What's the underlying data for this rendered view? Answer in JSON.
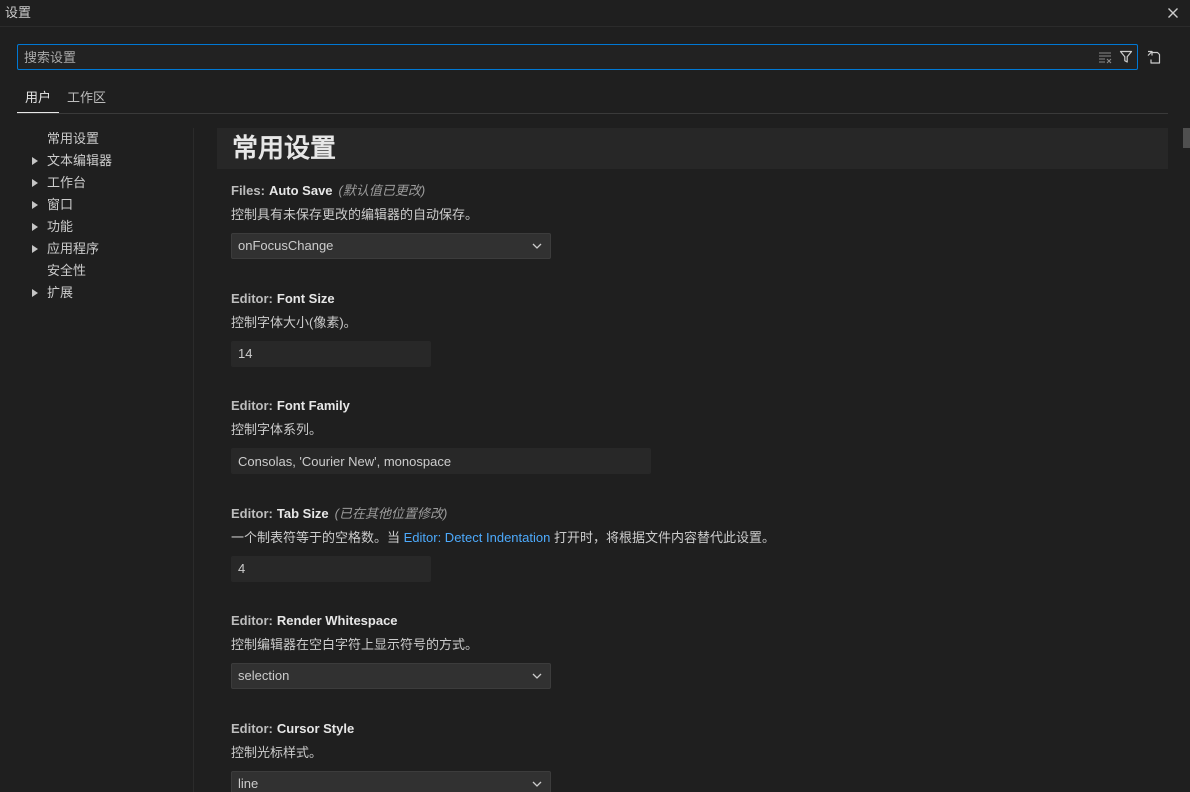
{
  "window": {
    "title": "设置",
    "close_icon": "close-icon"
  },
  "search": {
    "placeholder": "搜索设置",
    "icons": [
      "clear-filter-icon",
      "filter-icon"
    ],
    "open_json_icon": "open-settings-json-icon"
  },
  "tabs": [
    {
      "label": "用户",
      "active": true
    },
    {
      "label": "工作区",
      "active": false
    }
  ],
  "toc": [
    {
      "label": "常用设置",
      "expandable": false
    },
    {
      "label": "文本编辑器",
      "expandable": true
    },
    {
      "label": "工作台",
      "expandable": true
    },
    {
      "label": "窗口",
      "expandable": true
    },
    {
      "label": "功能",
      "expandable": true
    },
    {
      "label": "应用程序",
      "expandable": true
    },
    {
      "label": "安全性",
      "expandable": false
    },
    {
      "label": "扩展",
      "expandable": true
    }
  ],
  "section": {
    "title": "常用设置"
  },
  "settings": [
    {
      "category": "Files:",
      "name": "Auto Save",
      "modified": "(默认值已更改)",
      "description": "控制具有未保存更改的编辑器的自动保存。",
      "dropdown": true,
      "value": "onFocusChange"
    },
    {
      "category": "Editor:",
      "name": "Font Size",
      "description": "控制字体大小(像素)。",
      "dropdown": false,
      "value": "14"
    },
    {
      "category": "Editor:",
      "name": "Font Family",
      "description": "控制字体系列。",
      "dropdown": false,
      "value": "Consolas, 'Courier New', monospace"
    },
    {
      "category": "Editor:",
      "name": "Tab Size",
      "modified": "(已在其他位置修改)",
      "description": "一个制表符等于的空格数。当 ",
      "description_link": "Editor: Detect Indentation",
      "description_after": " 打开时，将根据文件内容替代此设置。",
      "dropdown": false,
      "value": "4"
    },
    {
      "category": "Editor:",
      "name": "Render Whitespace",
      "description": "控制编辑器在空白字符上显示符号的方式。",
      "dropdown": true,
      "value": "selection"
    },
    {
      "category": "Editor:",
      "name": "Cursor Style",
      "description": "控制光标样式。",
      "dropdown": true,
      "value": "line"
    }
  ],
  "colors": {
    "background": "#1f1f1f",
    "text": "#cccccc",
    "accent": "#0078d4",
    "link": "#4daafc",
    "dropdown_background": "#313131"
  }
}
